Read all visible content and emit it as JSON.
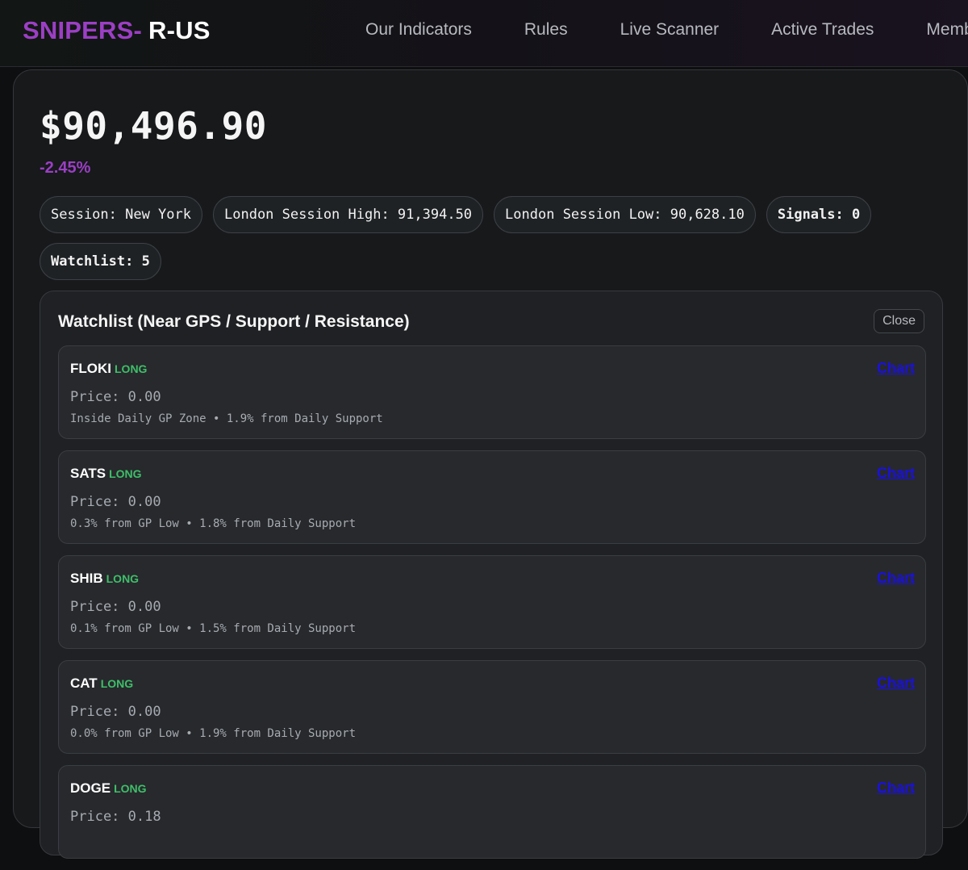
{
  "brand": {
    "part1": "SNIPERS-",
    "part2": "R-US"
  },
  "nav": [
    "Our Indicators",
    "Rules",
    "Live Scanner",
    "Active Trades",
    "Membership"
  ],
  "ticker": {
    "price": "$90,496.90",
    "change": "-2.45%"
  },
  "chips": [
    {
      "text": "Session: New York",
      "bold": false
    },
    {
      "text": "London Session High: 91,394.50",
      "bold": false
    },
    {
      "text": "London Session Low: 90,628.10",
      "bold": false
    },
    {
      "text": "Signals: 0",
      "bold": true
    },
    {
      "text": "Watchlist: 5",
      "bold": true
    }
  ],
  "watchlist": {
    "title": "Watchlist (Near GPS / Support / Resistance)",
    "close_label": "Close",
    "chart_label": "Chart",
    "items": [
      {
        "symbol": "FLOKI",
        "direction": "LONG",
        "price": "Price: 0.00",
        "note": "Inside Daily GP Zone • 1.9% from Daily Support"
      },
      {
        "symbol": "SATS",
        "direction": "LONG",
        "price": "Price: 0.00",
        "note": "0.3% from GP Low • 1.8% from Daily Support"
      },
      {
        "symbol": "SHIB",
        "direction": "LONG",
        "price": "Price: 0.00",
        "note": "0.1% from GP Low • 1.5% from Daily Support"
      },
      {
        "symbol": "CAT",
        "direction": "LONG",
        "price": "Price: 0.00",
        "note": "0.0% from GP Low • 1.9% from Daily Support"
      },
      {
        "symbol": "DOGE",
        "direction": "LONG",
        "price": "Price: 0.18",
        "note": ""
      }
    ]
  },
  "colors": {
    "brand_accent": "#9b3fc4",
    "long": "#3fbf6a",
    "link": "#1a10e0"
  }
}
